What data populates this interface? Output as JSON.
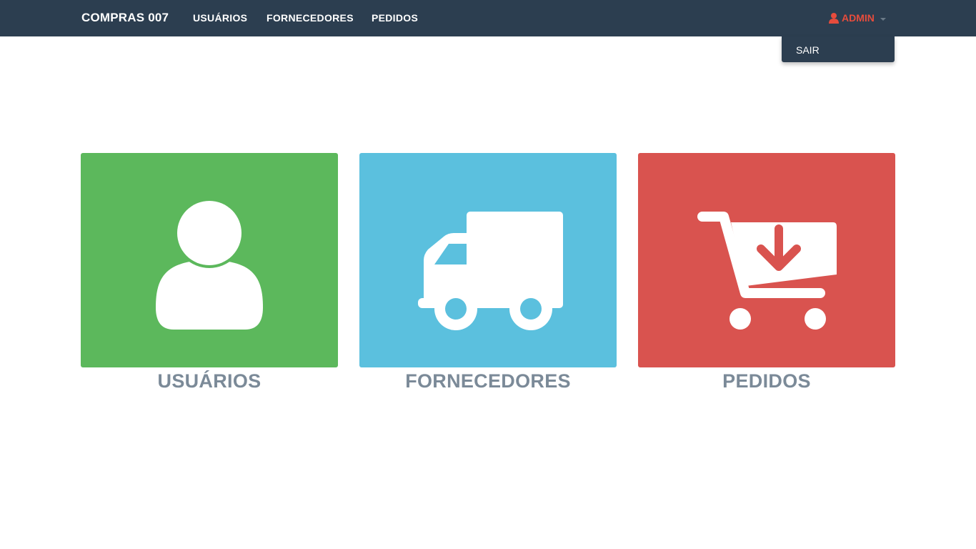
{
  "navbar": {
    "brand": "COMPRAS 007",
    "links": [
      {
        "label": "USUÁRIOS"
      },
      {
        "label": "FORNECEDORES"
      },
      {
        "label": "PEDIDOS"
      }
    ],
    "user": {
      "icon": "user-icon",
      "label": "ADMIN",
      "color": "#e74c3c"
    }
  },
  "dropdown": {
    "items": [
      {
        "label": "SAIR"
      }
    ]
  },
  "tiles": [
    {
      "label": "USUÁRIOS",
      "icon": "user-icon",
      "color": "#5cb85c"
    },
    {
      "label": "FORNECEDORES",
      "icon": "truck-icon",
      "color": "#5bc0de"
    },
    {
      "label": "PEDIDOS",
      "icon": "cart-download-icon",
      "color": "#d9534f"
    }
  ],
  "colors": {
    "navbar": "#2c3e50",
    "label_text": "#7b8a98"
  }
}
